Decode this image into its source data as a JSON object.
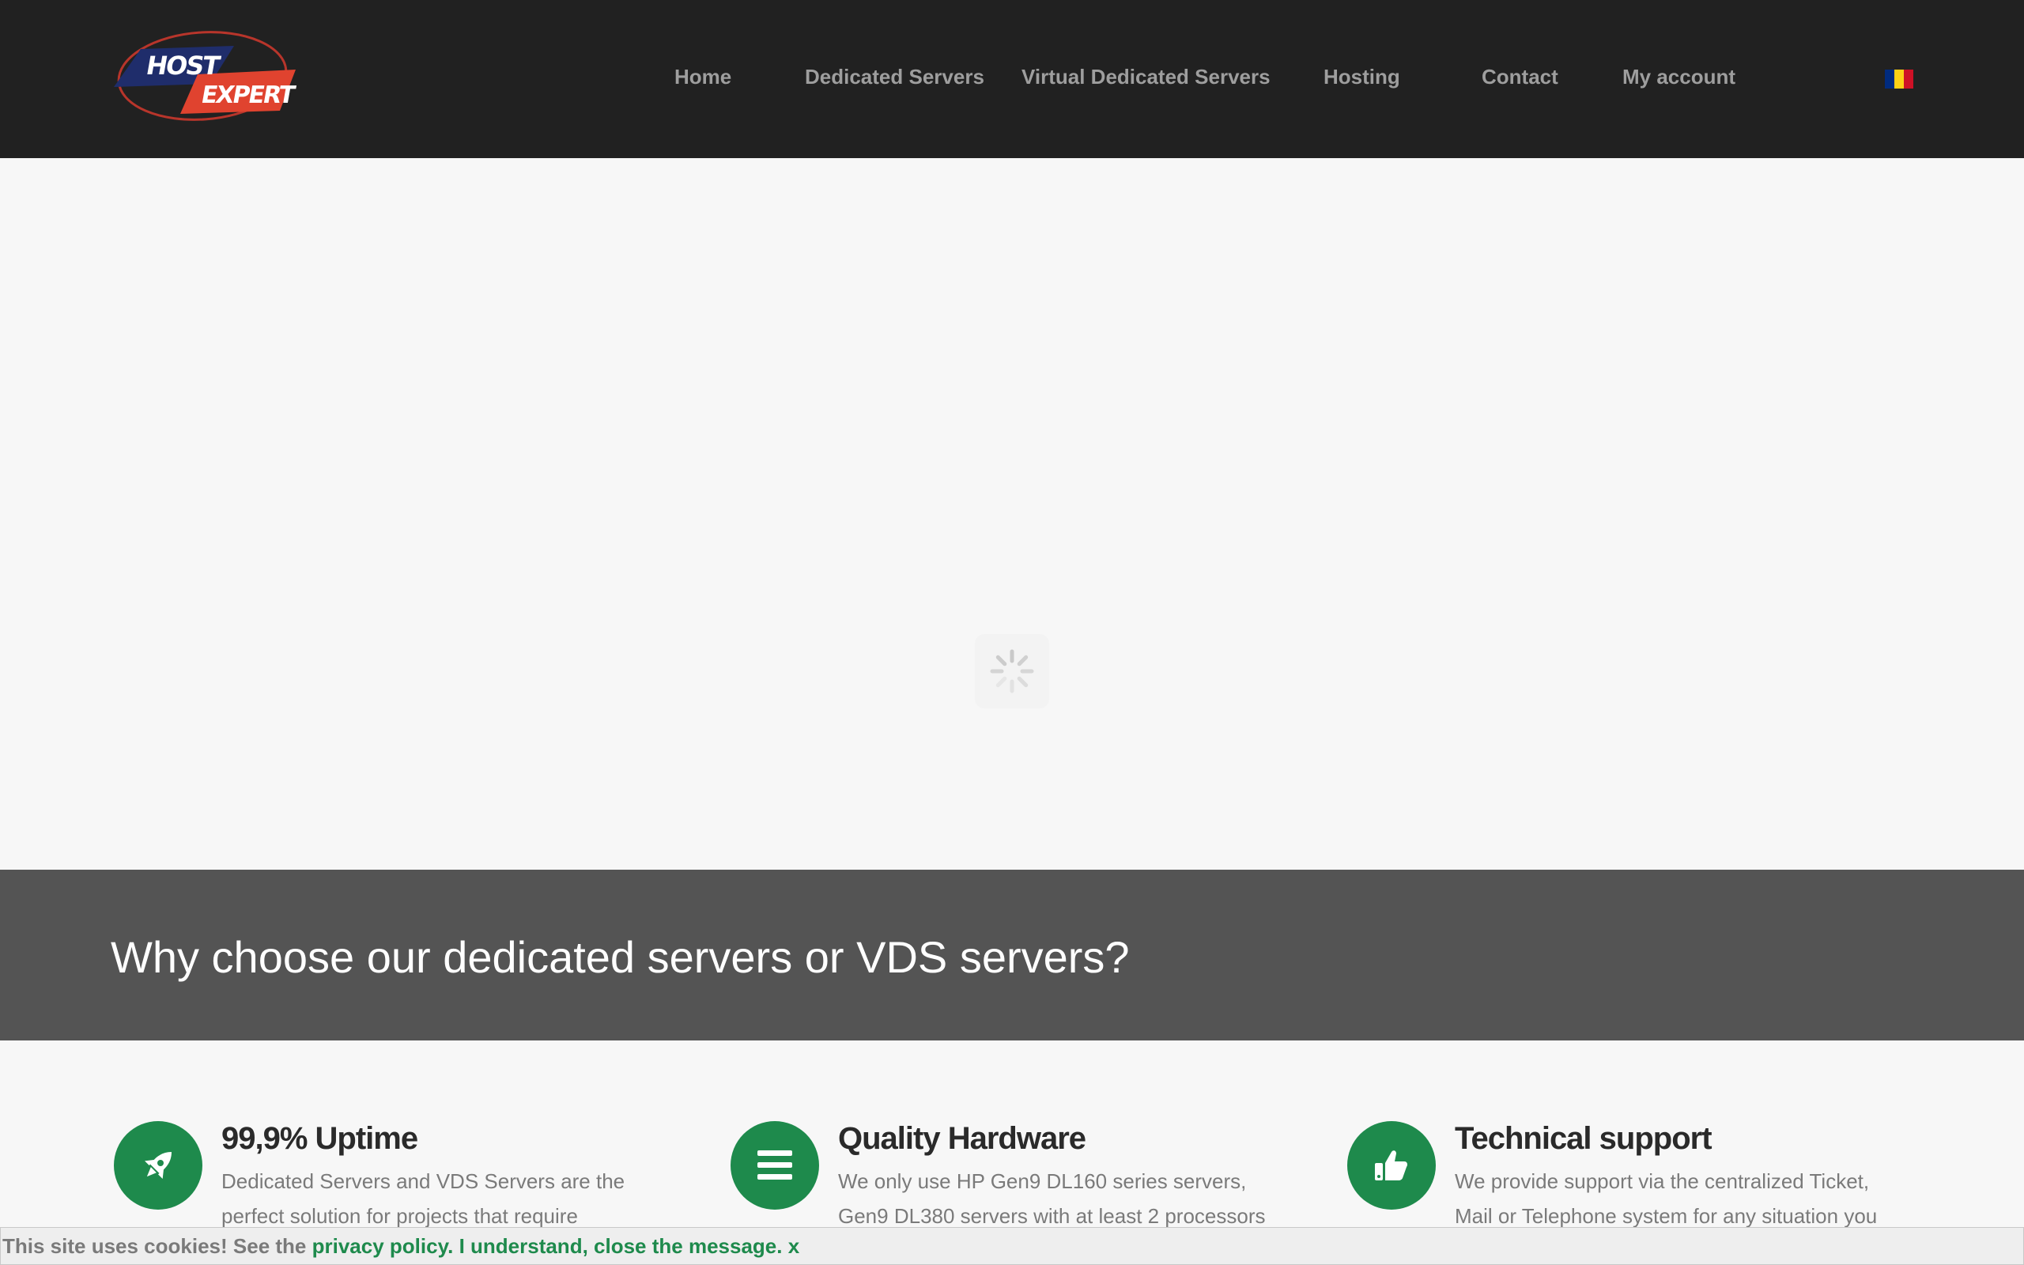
{
  "header": {
    "logo": {
      "line1": "HOST",
      "line2": "EXPERT"
    },
    "nav": [
      {
        "label": "Home"
      },
      {
        "label": "Dedicated Servers"
      },
      {
        "label": "Virtual Dedicated Servers"
      },
      {
        "label": "Hosting"
      },
      {
        "label": "Contact"
      },
      {
        "label": "My account"
      }
    ],
    "language_flag": {
      "icon": "romania-flag-icon",
      "colors": [
        "#002b7f",
        "#fcd116",
        "#ce1126"
      ]
    }
  },
  "hero": {
    "state_icon": "loading-spinner-icon"
  },
  "banner": {
    "title": "Why choose our dedicated servers or VDS servers?"
  },
  "features": [
    {
      "icon": "rocket-icon",
      "title": "99,9% Uptime",
      "text": "Dedicated Servers and VDS Servers are the perfect solution for projects that require"
    },
    {
      "icon": "list-icon",
      "title": "Quality Hardware",
      "text": "We only use HP Gen9 DL160 series servers, Gen9 DL380 servers with at least 2 processors"
    },
    {
      "icon": "thumbs-up-icon",
      "title": "Technical support",
      "text": "We provide support via the centralized Ticket, Mail or Telephone system for any situation you"
    }
  ],
  "cookie_bar": {
    "message": "This site uses cookies! See the ",
    "policy_link": "privacy policy.",
    "accept_link": "I understand, close the message.",
    "close_link": "x"
  },
  "colors": {
    "header_bg": "#212121",
    "nav_text": "#9e9e9e",
    "banner_bg": "#545454",
    "accent_green": "#1e8a4c",
    "page_bg": "#f7f7f7"
  }
}
